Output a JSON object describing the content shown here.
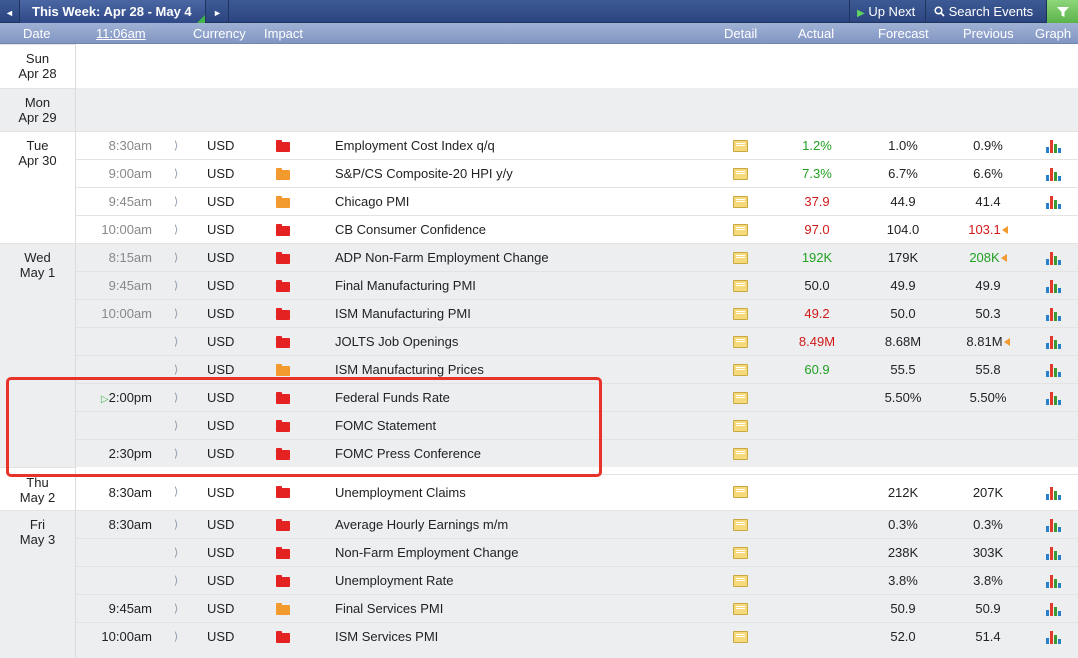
{
  "topbar": {
    "prev_glyph": "◄",
    "week_label": "This Week: Apr 28 - May 4",
    "next_glyph": "►",
    "up_next": "Up Next",
    "search_events": "Search Events",
    "filter_icon": "filter-icon"
  },
  "header": {
    "date": "Date",
    "time": "11:06am",
    "currency": "Currency",
    "impact": "Impact",
    "detail": "Detail",
    "actual": "Actual",
    "forecast": "Forecast",
    "previous": "Previous",
    "graph": "Graph"
  },
  "days": [
    {
      "dow": "Sun",
      "date": "Apr 28"
    },
    {
      "dow": "Mon",
      "date": "Apr 29"
    },
    {
      "dow": "Tue",
      "date": "Apr 30"
    },
    {
      "dow": "Wed",
      "date": "May 1"
    },
    {
      "dow": "Thu",
      "date": "May 2"
    },
    {
      "dow": "Fri",
      "date": "May 3"
    }
  ],
  "events": [
    {
      "time": "8:30am",
      "currency": "USD",
      "impact": "high",
      "event": "Employment Cost Index q/q",
      "actual": "1.2%",
      "actual_color": "green",
      "forecast": "1.0%",
      "previous": "0.9%",
      "previous_color": "",
      "previous_revised": false,
      "graph": true
    },
    {
      "time": "9:00am",
      "currency": "USD",
      "impact": "medium",
      "event": "S&P/CS Composite-20 HPI y/y",
      "actual": "7.3%",
      "actual_color": "green",
      "forecast": "6.7%",
      "previous": "6.6%",
      "previous_color": "",
      "previous_revised": false,
      "graph": true
    },
    {
      "time": "9:45am",
      "currency": "USD",
      "impact": "medium",
      "event": "Chicago PMI",
      "actual": "37.9",
      "actual_color": "red",
      "forecast": "44.9",
      "previous": "41.4",
      "previous_color": "",
      "previous_revised": false,
      "graph": true
    },
    {
      "time": "10:00am",
      "currency": "USD",
      "impact": "high",
      "event": "CB Consumer Confidence",
      "actual": "97.0",
      "actual_color": "red",
      "forecast": "104.0",
      "previous": "103.1",
      "previous_color": "red",
      "previous_revised": true,
      "graph": false
    },
    {
      "time": "8:15am",
      "currency": "USD",
      "impact": "high",
      "event": "ADP Non-Farm Employment Change",
      "actual": "192K",
      "actual_color": "green",
      "forecast": "179K",
      "previous": "208K",
      "previous_color": "green",
      "previous_revised": true,
      "graph": true
    },
    {
      "time": "9:45am",
      "currency": "USD",
      "impact": "high",
      "event": "Final Manufacturing PMI",
      "actual": "50.0",
      "actual_color": "",
      "forecast": "49.9",
      "previous": "49.9",
      "previous_color": "",
      "previous_revised": false,
      "graph": true
    },
    {
      "time": "10:00am",
      "currency": "USD",
      "impact": "high",
      "event": "ISM Manufacturing PMI",
      "actual": "49.2",
      "actual_color": "red",
      "forecast": "50.0",
      "previous": "50.3",
      "previous_color": "",
      "previous_revised": false,
      "graph": true
    },
    {
      "time": "",
      "currency": "USD",
      "impact": "high",
      "event": "JOLTS Job Openings",
      "actual": "8.49M",
      "actual_color": "red",
      "forecast": "8.68M",
      "previous": "8.81M",
      "previous_color": "",
      "previous_revised": true,
      "graph": true
    },
    {
      "time": "",
      "currency": "USD",
      "impact": "medium",
      "event": "ISM Manufacturing Prices",
      "actual": "60.9",
      "actual_color": "green",
      "forecast": "55.5",
      "previous": "55.8",
      "previous_color": "",
      "previous_revised": false,
      "graph": true
    },
    {
      "time": "2:00pm",
      "currency": "USD",
      "impact": "high",
      "event": "Federal Funds Rate",
      "actual": "",
      "actual_color": "",
      "forecast": "5.50%",
      "previous": "5.50%",
      "previous_color": "",
      "previous_revised": false,
      "graph": true,
      "up_next": true
    },
    {
      "time": "",
      "currency": "USD",
      "impact": "high",
      "event": "FOMC Statement",
      "actual": "",
      "actual_color": "",
      "forecast": "",
      "previous": "",
      "previous_color": "",
      "previous_revised": false,
      "graph": false
    },
    {
      "time": "2:30pm",
      "currency": "USD",
      "impact": "high",
      "event": "FOMC Press Conference",
      "actual": "",
      "actual_color": "",
      "forecast": "",
      "previous": "",
      "previous_color": "",
      "previous_revised": false,
      "graph": false
    },
    {
      "time": "8:30am",
      "currency": "USD",
      "impact": "high",
      "event": "Unemployment Claims",
      "actual": "",
      "actual_color": "",
      "forecast": "212K",
      "previous": "207K",
      "previous_color": "",
      "previous_revised": false,
      "graph": true
    },
    {
      "time": "8:30am",
      "currency": "USD",
      "impact": "high",
      "event": "Average Hourly Earnings m/m",
      "actual": "",
      "actual_color": "",
      "forecast": "0.3%",
      "previous": "0.3%",
      "previous_color": "",
      "previous_revised": false,
      "graph": true
    },
    {
      "time": "",
      "currency": "USD",
      "impact": "high",
      "event": "Non-Farm Employment Change",
      "actual": "",
      "actual_color": "",
      "forecast": "238K",
      "previous": "303K",
      "previous_color": "",
      "previous_revised": false,
      "graph": true
    },
    {
      "time": "",
      "currency": "USD",
      "impact": "high",
      "event": "Unemployment Rate",
      "actual": "",
      "actual_color": "",
      "forecast": "3.8%",
      "previous": "3.8%",
      "previous_color": "",
      "previous_revised": false,
      "graph": true
    },
    {
      "time": "9:45am",
      "currency": "USD",
      "impact": "medium",
      "event": "Final Services PMI",
      "actual": "",
      "actual_color": "",
      "forecast": "50.9",
      "previous": "50.9",
      "previous_color": "",
      "previous_revised": false,
      "graph": true
    },
    {
      "time": "10:00am",
      "currency": "USD",
      "impact": "high",
      "event": "ISM Services PMI",
      "actual": "",
      "actual_color": "",
      "forecast": "52.0",
      "previous": "51.4",
      "previous_color": "",
      "previous_revised": false,
      "graph": true
    }
  ],
  "colors": {
    "impact_high": "#e52222",
    "impact_medium": "#f39a2e",
    "better": "#22a022",
    "worse": "#d11a1a",
    "highlight": "#e8332a"
  }
}
